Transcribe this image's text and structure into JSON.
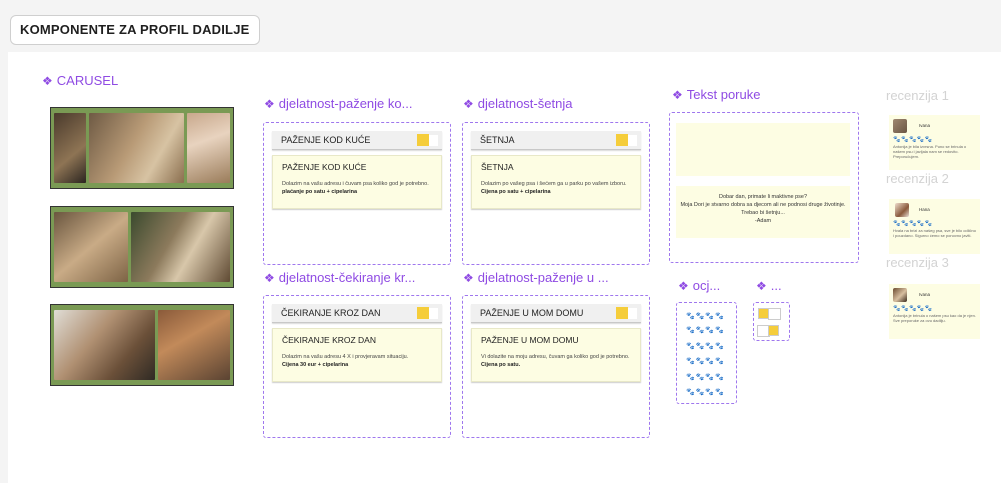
{
  "page": {
    "tab_label": "KOMPONENTE ZA PROFIL DADILJE"
  },
  "carousel": {
    "title": "CARUSEL"
  },
  "components": [
    {
      "title": "djelatnost-paženje ko...",
      "button_label": "PAŽENJE KOD KUĆE",
      "card_title": "PAŽENJE KOD KUĆE",
      "card_desc": "Dolazim na vašu adresu i čuvam psa koliko god je potrebno.",
      "card_price": "plaćanje po satu + cipelarina"
    },
    {
      "title": "djelatnost-šetnja",
      "button_label": "ŠETNJA",
      "card_title": "ŠETNJA",
      "card_desc": "Dolazim po vašeg psa i šećem ga u parku po vašem izboru.",
      "card_price": "Cijena po satu + cipelarina"
    },
    {
      "title": "djelatnost-čekiranje kr...",
      "button_label": "ČEKIRANJE KROZ DAN",
      "card_title": "ČEKIRANJE KROZ DAN",
      "card_desc": "Dolazim na vašu adresu 4 X i provjeravam situaciju.",
      "card_price": "Cijena 30 eur + cipelarina"
    },
    {
      "title": "djelatnost-paženje u ...",
      "button_label": "PAŽENJE U MOM DOMU",
      "card_title": "PAŽENJE U MOM DOMU",
      "card_desc": "Vi dolazite na moju adresu, čuvam ga koliko god je potrebno.",
      "card_price": "Cijena po satu."
    }
  ],
  "message": {
    "title": "Tekst poruke",
    "lines": [
      "Dobar dan, primate li maktivne pse?",
      "Moja Dori je stvarno dobra sa djecom ali ne podnosi druge životinje.",
      "Trebao bi šetnju...",
      "-Adam"
    ]
  },
  "rating": {
    "title": "ocj...",
    "rows": [
      "🐾🐾🐾🐾",
      "🐾🐾🐾🐾",
      "🐾🐾🐾🐾",
      "🐾🐾🐾🐾",
      "🐾🐾🐾🐾",
      "🐾🐾🐾🐾"
    ]
  },
  "toggle": {
    "title": "..."
  },
  "reviews": [
    {
      "title": "recenzija 1",
      "name": "Ivana",
      "stars": "🐾🐾🐾🐾🐾",
      "text": "Antonija je bila izvrsna. Puno se brinula o našem psu i javljala nam se redovito. Preporučujem."
    },
    {
      "title": "recenzija 2",
      "name": "Hana",
      "stars": "🐾🐾🐾🐾🐾",
      "text": "Hvala na brizi za našeg psa, sve je bilo odlično i pouzdano. Sigurno ćemo se ponovno javiti."
    },
    {
      "title": "recenzija 3",
      "name": "Ivana",
      "stars": "🐾🐾🐾🐾🐾",
      "text": "Antonija je brinula o našem psu kao da je njen. Sve preporuke za ovu dadilju."
    }
  ],
  "colors": {
    "accent": "#8f4be3",
    "card_bg": "#fdfde3",
    "toggle_yellow": "#f5cd3a",
    "carousel_bg": "#7a9a54"
  }
}
